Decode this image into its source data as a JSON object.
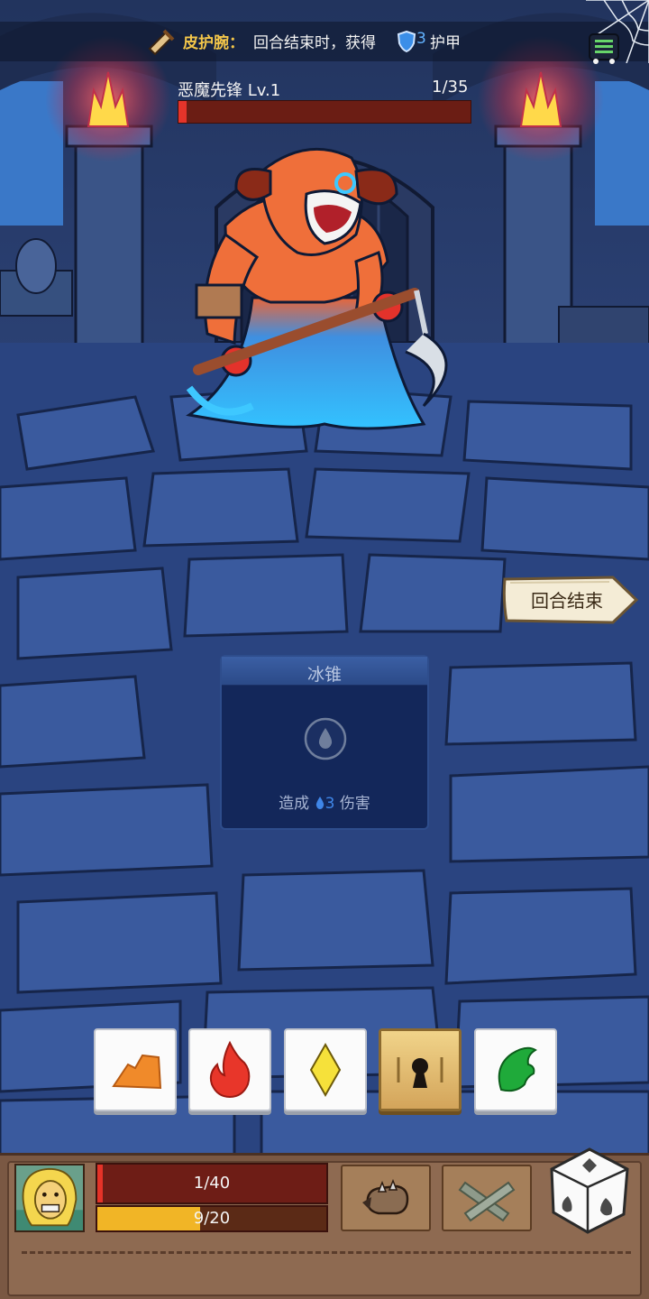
{
  "buff": {
    "name": "皮护腕：",
    "description": "回合结束时，获得",
    "armor_value": "3",
    "suffix": "护甲",
    "icon": "bracer-icon"
  },
  "enemy": {
    "name": "恶魔先锋  Lv.1",
    "hp_text": "1/35",
    "hp_current": 1,
    "hp_max": 35
  },
  "end_turn_label": "回合结束",
  "skill_card": {
    "title": "冰锥",
    "desc_prefix": "造成",
    "desc_value": "3",
    "desc_suffix": "伤害",
    "slot_icon": "water-drop-icon"
  },
  "dice": [
    {
      "face": "earth",
      "icon": "earth-rock-icon",
      "locked": false
    },
    {
      "face": "fire",
      "icon": "fire-icon",
      "locked": false
    },
    {
      "face": "light",
      "icon": "yellow-diamond-icon",
      "locked": false
    },
    {
      "face": "locked",
      "icon": "lock-icon",
      "locked": true
    },
    {
      "face": "nature",
      "icon": "green-leaf-icon",
      "locked": false
    }
  ],
  "player": {
    "hp_text": "1/40",
    "hp_current": 1,
    "hp_max": 40,
    "xp_text": "9/20",
    "xp_current": 9,
    "xp_max": 20,
    "portrait": "hero-portrait"
  },
  "abilities": [
    {
      "icon": "spiked-fist-icon"
    },
    {
      "icon": "crossed-bandage-icon"
    }
  ],
  "colors": {
    "hp": "#e53328",
    "xp": "#f1b526",
    "enemy_hp": "#e4342a",
    "buff_name": "#f3c64a",
    "armor": "#62b2ff"
  }
}
